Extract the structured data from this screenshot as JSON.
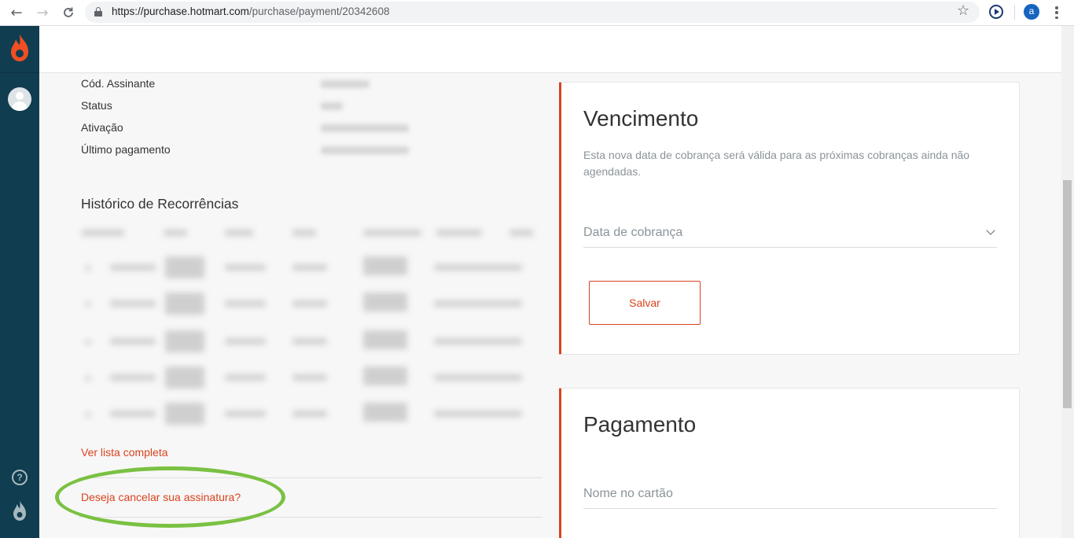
{
  "browser": {
    "url_host": "https://purchase.hotmart.com",
    "url_path": "/purchase/payment/20342608",
    "profile_initial": "a"
  },
  "sidebar": {
    "logo_icon": "hotmart-flame-icon",
    "help_icon": "question-circle-icon",
    "bottom_icon": "flame-icon"
  },
  "subscription_info": {
    "rows": [
      {
        "label": "Cód. Assinante"
      },
      {
        "label": "Status"
      },
      {
        "label": "Ativação"
      },
      {
        "label": "Último pagamento"
      }
    ]
  },
  "history": {
    "title": "Histórico de Recorrências",
    "see_full_list": "Ver lista completa"
  },
  "cancel": {
    "link": "Deseja cancelar sua assinatura?",
    "highlight_color": "#7ac142"
  },
  "due_date": {
    "title": "Vencimento",
    "description": "Esta nova data de cobrança será válida para as próximas cobranças ainda não agendadas.",
    "field_label": "Data de cobrança",
    "save_label": "Salvar"
  },
  "payment": {
    "title": "Pagamento",
    "card_name_label": "Nome no cartão"
  },
  "colors": {
    "accent": "#d9431e",
    "sidebar": "#103d4f"
  }
}
